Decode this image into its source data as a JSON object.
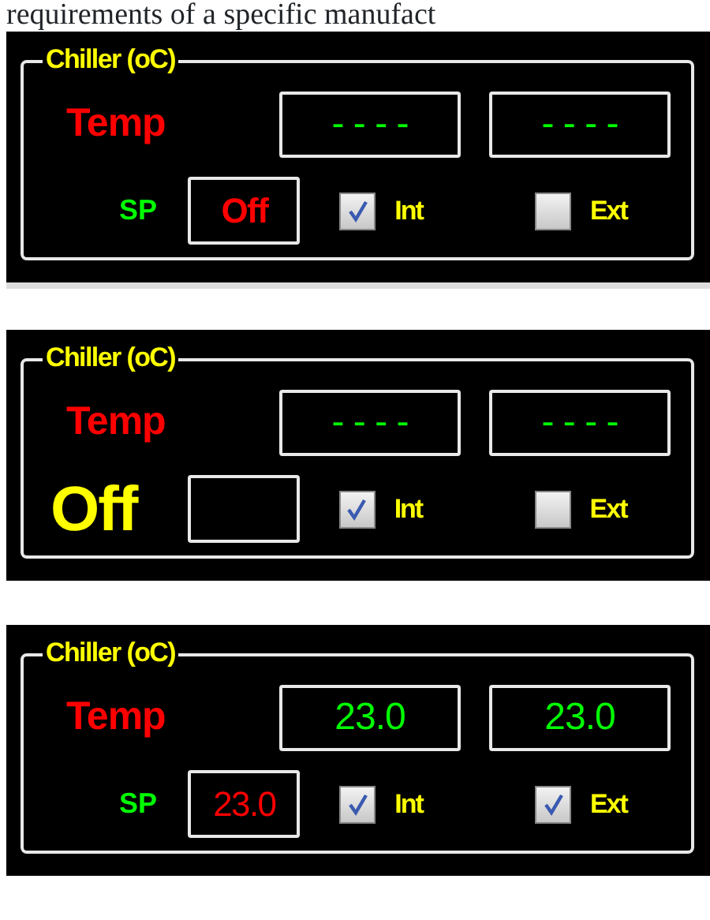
{
  "document_text": "requirements of a specific manufact",
  "panels": [
    {
      "title": "Chiller (oC)",
      "temp_label": "Temp",
      "temp_values": [
        "- - - -",
        "- - - -"
      ],
      "sp_label": {
        "kind": "tag",
        "text": "SP"
      },
      "sp_value": "Off",
      "checkboxes": [
        {
          "label": "Int",
          "checked": true
        },
        {
          "label": "Ext",
          "checked": false
        }
      ]
    },
    {
      "title": "Chiller (oC)",
      "temp_label": "Temp",
      "temp_values": [
        "- - - -",
        "- - - -"
      ],
      "sp_label": {
        "kind": "status",
        "text": "Off"
      },
      "checkboxes": [
        {
          "label": "Int",
          "checked": true
        },
        {
          "label": "Ext",
          "checked": false
        }
      ]
    },
    {
      "title": "Chiller (oC)",
      "temp_label": "Temp",
      "temp_values": [
        "23.0",
        "23.0"
      ],
      "sp_label": {
        "kind": "tag",
        "text": "SP"
      },
      "sp_value": "23.0",
      "checkboxes": [
        {
          "label": "Int",
          "checked": true
        },
        {
          "label": "Ext",
          "checked": true
        }
      ]
    }
  ]
}
